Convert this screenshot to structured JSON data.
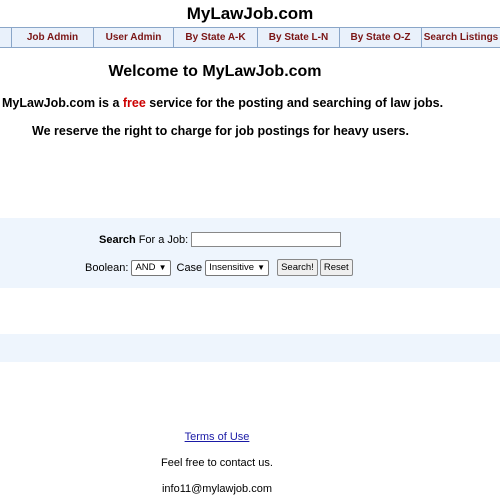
{
  "header": {
    "title": "MyLawJob.com"
  },
  "nav": {
    "items": [
      "Job Admin",
      "User Admin",
      "By State A-K",
      "By State L-N",
      "By State O-Z",
      "Search Listings"
    ]
  },
  "welcome": {
    "heading": "Welcome to MyLawJob.com",
    "intro_prefix": "MyLawJob.com is a ",
    "intro_highlight": "free",
    "intro_suffix": " service for the posting and searching of law jobs.",
    "reserve": "We reserve the right to charge for job postings for heavy users."
  },
  "search": {
    "label_bold": "Search",
    "label_rest": "For a Job:",
    "input_value": "",
    "boolean_label": "Boolean:",
    "boolean_selected": "AND",
    "case_label": "Case",
    "case_selected": "Insensitive",
    "search_button": "Search!",
    "reset_button": "Reset"
  },
  "footer": {
    "terms": "Terms of Use",
    "contact": "Feel free to contact us.",
    "email": "info11@mylawjob.com"
  },
  "colors": {
    "nav_text": "#7a1515",
    "nav_bg": "#e9f1fb",
    "free_text": "#cc0000",
    "link": "#1a1aa6"
  }
}
